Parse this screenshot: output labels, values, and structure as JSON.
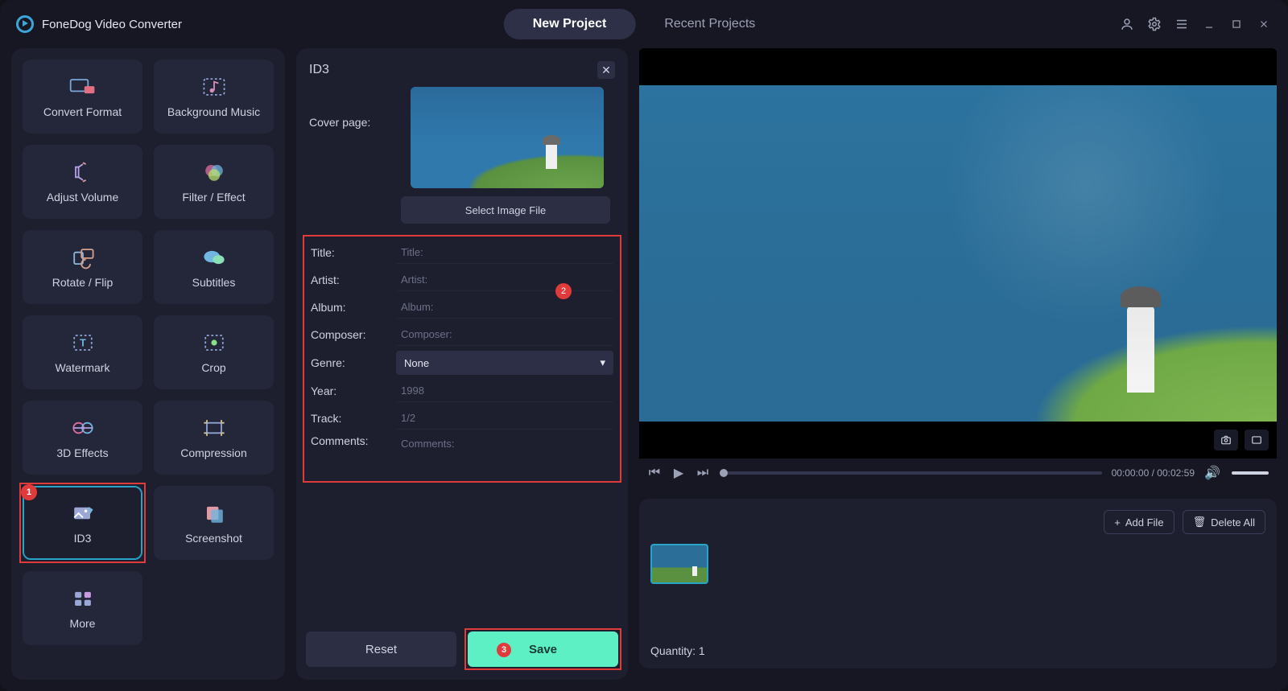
{
  "app_title": "FoneDog Video Converter",
  "tabs": {
    "new": "New Project",
    "recent": "Recent Projects"
  },
  "tools": {
    "convert": "Convert Format",
    "bgmusic": "Background Music",
    "volume": "Adjust Volume",
    "filter": "Filter / Effect",
    "rotate": "Rotate / Flip",
    "subtitles": "Subtitles",
    "watermark": "Watermark",
    "crop": "Crop",
    "threeD": "3D Effects",
    "compression": "Compression",
    "id3": "ID3",
    "screenshot": "Screenshot",
    "more": "More"
  },
  "badges": {
    "id3": "1",
    "form": "2",
    "save": "3"
  },
  "editor": {
    "title": "ID3",
    "cover_label": "Cover page:",
    "select_image": "Select Image File",
    "fields": {
      "title": {
        "label": "Title:",
        "placeholder": "Title:"
      },
      "artist": {
        "label": "Artist:",
        "placeholder": "Artist:"
      },
      "album": {
        "label": "Album:",
        "placeholder": "Album:"
      },
      "composer": {
        "label": "Composer:",
        "placeholder": "Composer:"
      },
      "genre": {
        "label": "Genre:",
        "value": "None"
      },
      "year": {
        "label": "Year:",
        "placeholder": "1998"
      },
      "track": {
        "label": "Track:",
        "placeholder": "1/2"
      },
      "comments": {
        "label": "Comments:",
        "placeholder": "Comments:"
      }
    },
    "reset": "Reset",
    "save": "Save"
  },
  "player": {
    "time": "00:00:00 / 00:02:59"
  },
  "gallery": {
    "add_file": "Add File",
    "delete_all": "Delete All",
    "quantity_label": "Quantity: 1"
  }
}
